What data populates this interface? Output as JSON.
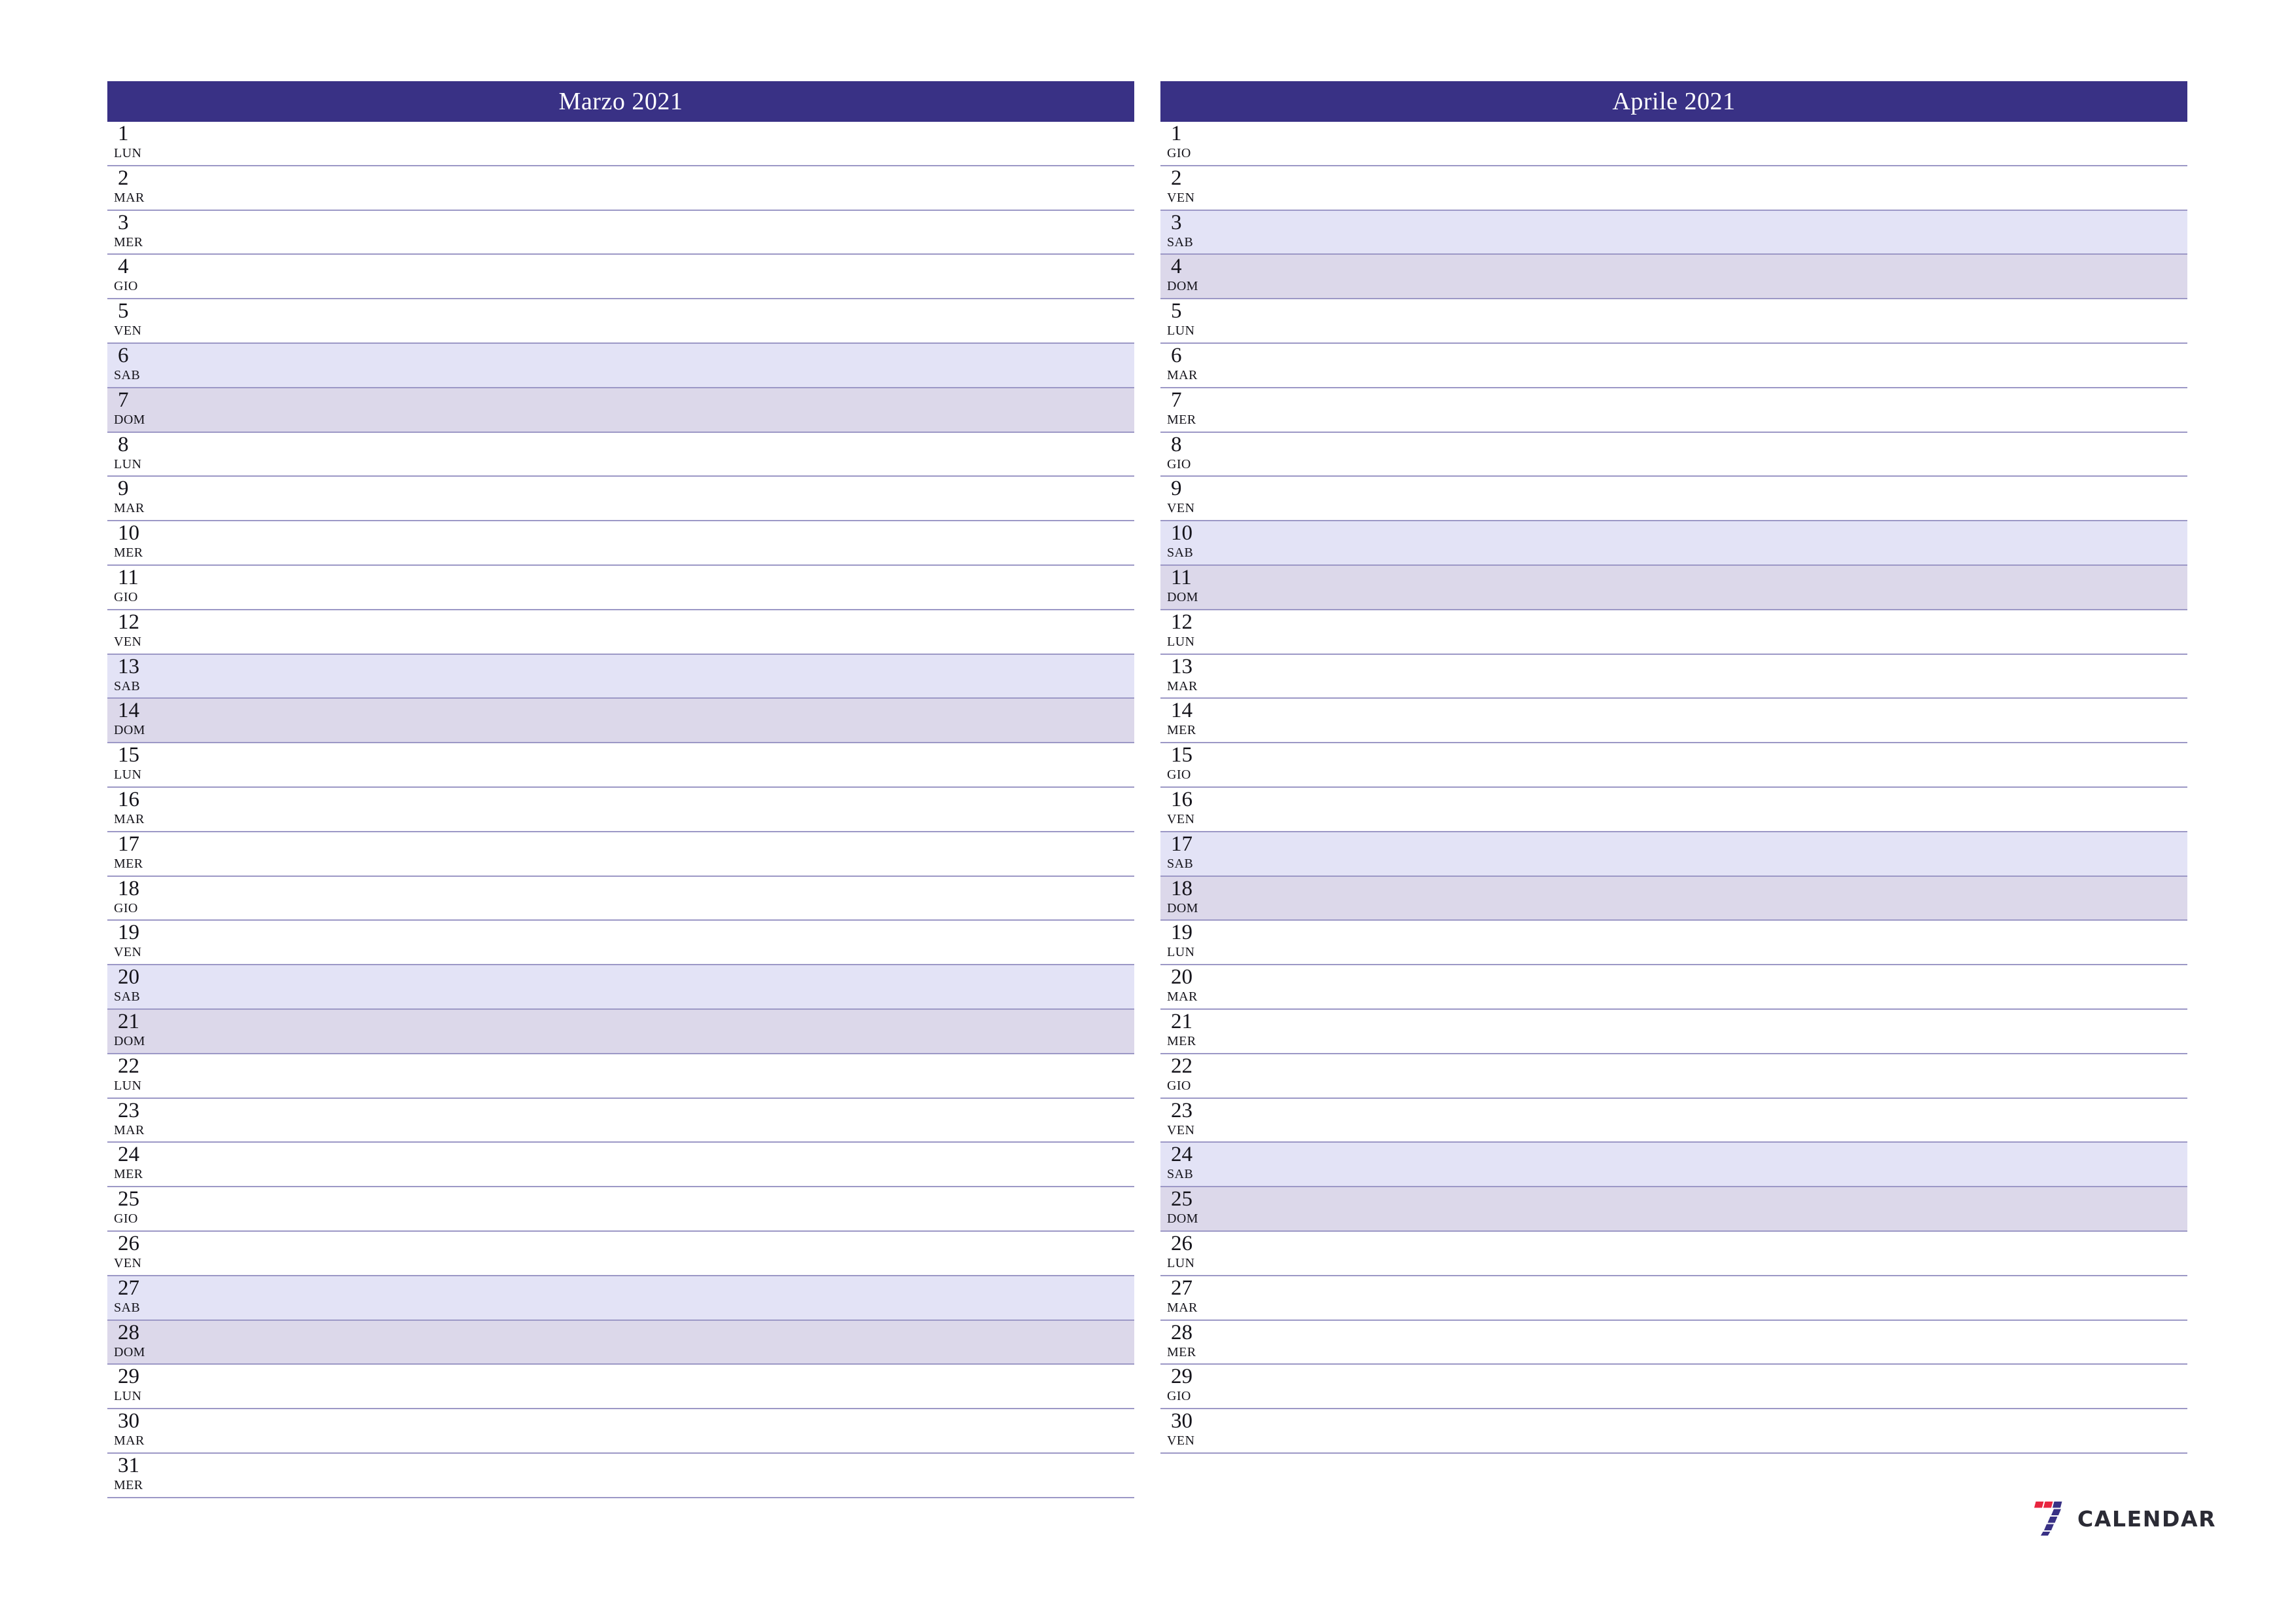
{
  "page": {
    "background": "#ffffff",
    "accent": "#393185",
    "saturday_color": "#e3e3f6",
    "sunday_color": "#dcd8ea",
    "rule_color": "#9c98c6"
  },
  "months": [
    {
      "title": "Marzo 2021",
      "days": [
        {
          "num": "1",
          "weekday": "LUN",
          "kind": "weekday"
        },
        {
          "num": "2",
          "weekday": "MAR",
          "kind": "weekday"
        },
        {
          "num": "3",
          "weekday": "MER",
          "kind": "weekday"
        },
        {
          "num": "4",
          "weekday": "GIO",
          "kind": "weekday"
        },
        {
          "num": "5",
          "weekday": "VEN",
          "kind": "weekday"
        },
        {
          "num": "6",
          "weekday": "SAB",
          "kind": "sat"
        },
        {
          "num": "7",
          "weekday": "DOM",
          "kind": "sun"
        },
        {
          "num": "8",
          "weekday": "LUN",
          "kind": "weekday"
        },
        {
          "num": "9",
          "weekday": "MAR",
          "kind": "weekday"
        },
        {
          "num": "10",
          "weekday": "MER",
          "kind": "weekday"
        },
        {
          "num": "11",
          "weekday": "GIO",
          "kind": "weekday"
        },
        {
          "num": "12",
          "weekday": "VEN",
          "kind": "weekday"
        },
        {
          "num": "13",
          "weekday": "SAB",
          "kind": "sat"
        },
        {
          "num": "14",
          "weekday": "DOM",
          "kind": "sun"
        },
        {
          "num": "15",
          "weekday": "LUN",
          "kind": "weekday"
        },
        {
          "num": "16",
          "weekday": "MAR",
          "kind": "weekday"
        },
        {
          "num": "17",
          "weekday": "MER",
          "kind": "weekday"
        },
        {
          "num": "18",
          "weekday": "GIO",
          "kind": "weekday"
        },
        {
          "num": "19",
          "weekday": "VEN",
          "kind": "weekday"
        },
        {
          "num": "20",
          "weekday": "SAB",
          "kind": "sat"
        },
        {
          "num": "21",
          "weekday": "DOM",
          "kind": "sun"
        },
        {
          "num": "22",
          "weekday": "LUN",
          "kind": "weekday"
        },
        {
          "num": "23",
          "weekday": "MAR",
          "kind": "weekday"
        },
        {
          "num": "24",
          "weekday": "MER",
          "kind": "weekday"
        },
        {
          "num": "25",
          "weekday": "GIO",
          "kind": "weekday"
        },
        {
          "num": "26",
          "weekday": "VEN",
          "kind": "weekday"
        },
        {
          "num": "27",
          "weekday": "SAB",
          "kind": "sat"
        },
        {
          "num": "28",
          "weekday": "DOM",
          "kind": "sun"
        },
        {
          "num": "29",
          "weekday": "LUN",
          "kind": "weekday"
        },
        {
          "num": "30",
          "weekday": "MAR",
          "kind": "weekday"
        },
        {
          "num": "31",
          "weekday": "MER",
          "kind": "weekday"
        }
      ]
    },
    {
      "title": "Aprile 2021",
      "days": [
        {
          "num": "1",
          "weekday": "GIO",
          "kind": "weekday"
        },
        {
          "num": "2",
          "weekday": "VEN",
          "kind": "weekday"
        },
        {
          "num": "3",
          "weekday": "SAB",
          "kind": "sat"
        },
        {
          "num": "4",
          "weekday": "DOM",
          "kind": "sun"
        },
        {
          "num": "5",
          "weekday": "LUN",
          "kind": "weekday"
        },
        {
          "num": "6",
          "weekday": "MAR",
          "kind": "weekday"
        },
        {
          "num": "7",
          "weekday": "MER",
          "kind": "weekday"
        },
        {
          "num": "8",
          "weekday": "GIO",
          "kind": "weekday"
        },
        {
          "num": "9",
          "weekday": "VEN",
          "kind": "weekday"
        },
        {
          "num": "10",
          "weekday": "SAB",
          "kind": "sat"
        },
        {
          "num": "11",
          "weekday": "DOM",
          "kind": "sun"
        },
        {
          "num": "12",
          "weekday": "LUN",
          "kind": "weekday"
        },
        {
          "num": "13",
          "weekday": "MAR",
          "kind": "weekday"
        },
        {
          "num": "14",
          "weekday": "MER",
          "kind": "weekday"
        },
        {
          "num": "15",
          "weekday": "GIO",
          "kind": "weekday"
        },
        {
          "num": "16",
          "weekday": "VEN",
          "kind": "weekday"
        },
        {
          "num": "17",
          "weekday": "SAB",
          "kind": "sat"
        },
        {
          "num": "18",
          "weekday": "DOM",
          "kind": "sun"
        },
        {
          "num": "19",
          "weekday": "LUN",
          "kind": "weekday"
        },
        {
          "num": "20",
          "weekday": "MAR",
          "kind": "weekday"
        },
        {
          "num": "21",
          "weekday": "MER",
          "kind": "weekday"
        },
        {
          "num": "22",
          "weekday": "GIO",
          "kind": "weekday"
        },
        {
          "num": "23",
          "weekday": "VEN",
          "kind": "weekday"
        },
        {
          "num": "24",
          "weekday": "SAB",
          "kind": "sat"
        },
        {
          "num": "25",
          "weekday": "DOM",
          "kind": "sun"
        },
        {
          "num": "26",
          "weekday": "LUN",
          "kind": "weekday"
        },
        {
          "num": "27",
          "weekday": "MAR",
          "kind": "weekday"
        },
        {
          "num": "28",
          "weekday": "MER",
          "kind": "weekday"
        },
        {
          "num": "29",
          "weekday": "GIO",
          "kind": "weekday"
        },
        {
          "num": "30",
          "weekday": "VEN",
          "kind": "weekday"
        }
      ]
    }
  ],
  "brand": {
    "name": "CALENDAR",
    "mark": "seven-logo-icon",
    "mark_colors": {
      "red": "#e8253f",
      "indigo": "#393185"
    }
  }
}
